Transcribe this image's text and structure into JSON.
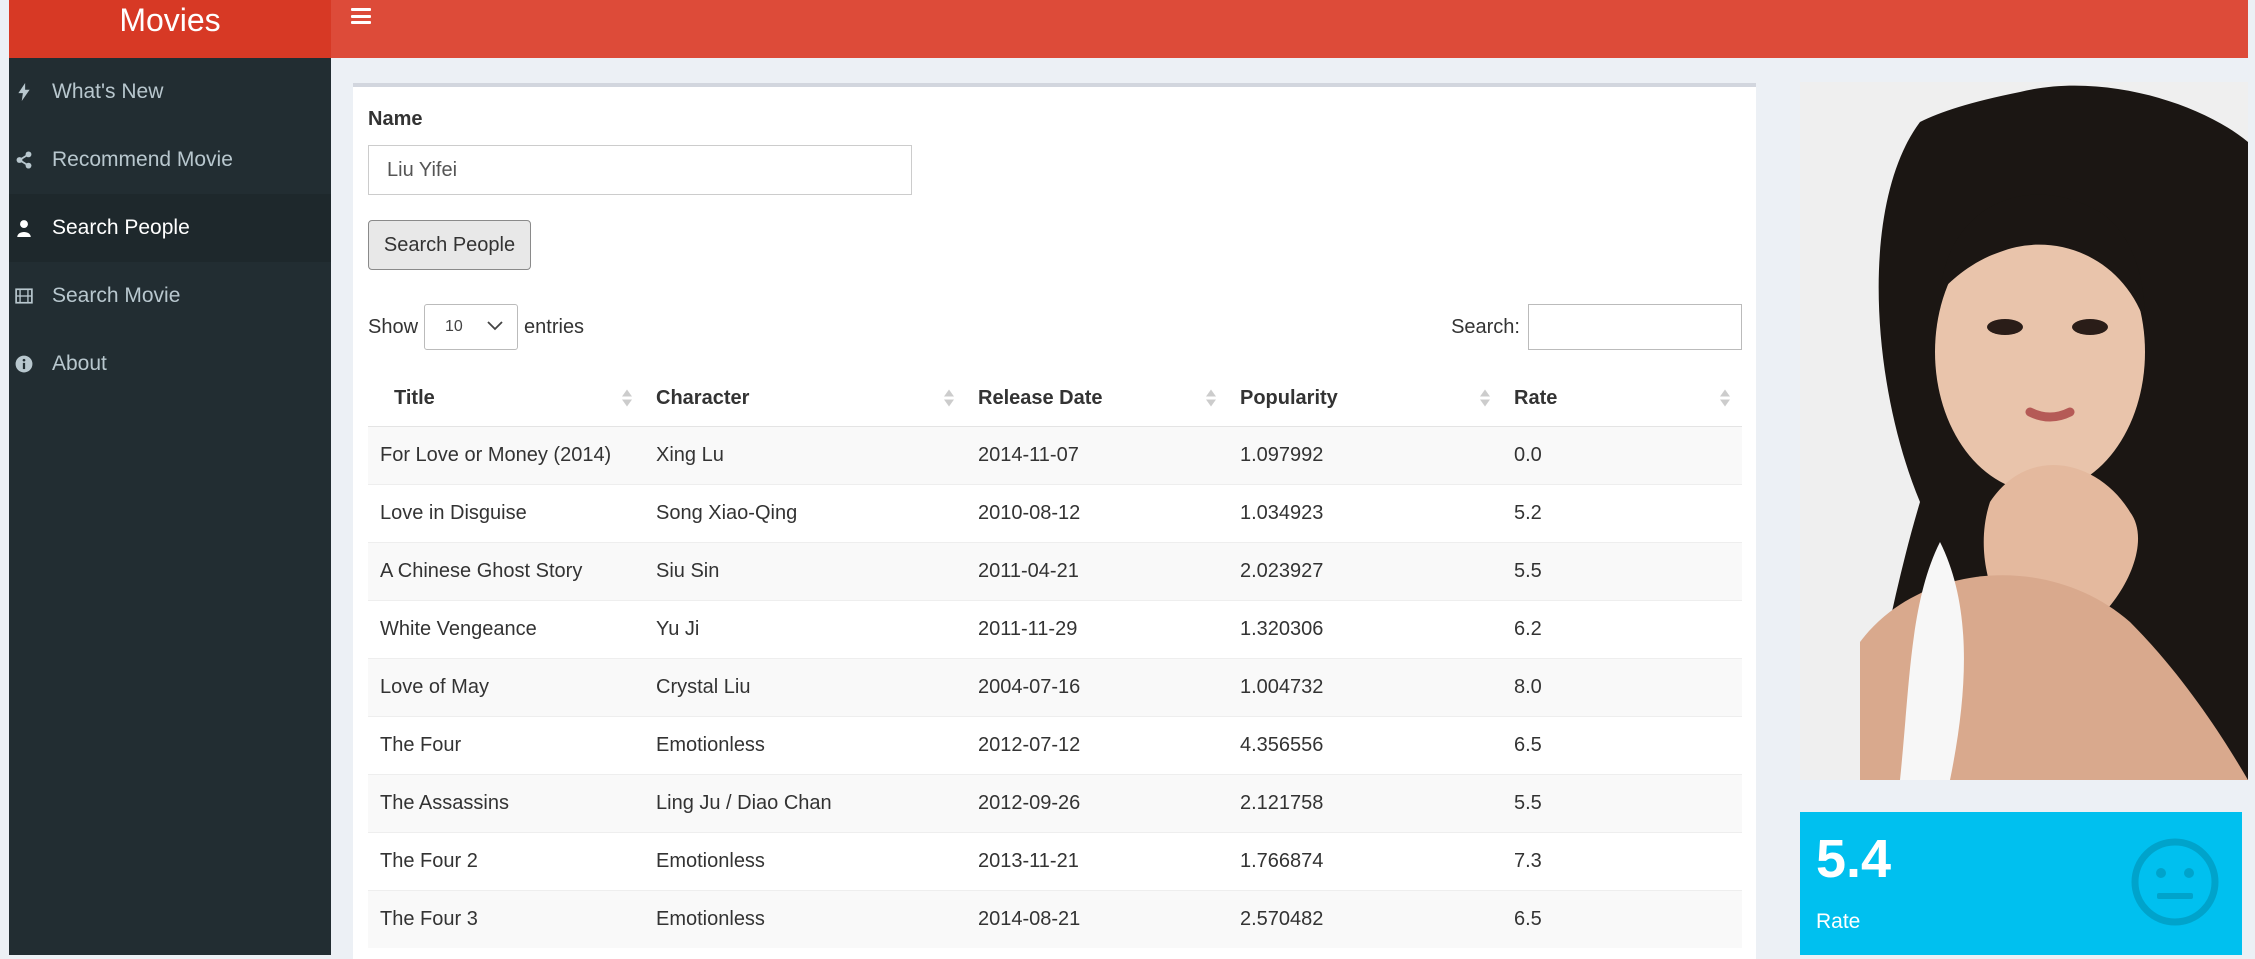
{
  "app": {
    "brand": "Movies"
  },
  "sidebar": {
    "items": [
      {
        "label": "What's New",
        "icon": "bolt-icon"
      },
      {
        "label": "Recommend Movie",
        "icon": "share-icon"
      },
      {
        "label": "Search People",
        "icon": "user-icon",
        "active": true
      },
      {
        "label": "Search Movie",
        "icon": "film-icon"
      },
      {
        "label": "About",
        "icon": "info-icon"
      }
    ]
  },
  "form": {
    "name_label": "Name",
    "name_value": "Liu Yifei",
    "search_button": "Search People"
  },
  "table_controls": {
    "show_label": "Show",
    "entries_value": "10",
    "entries_label": "entries",
    "search_label": "Search:"
  },
  "table": {
    "columns": [
      "Title",
      "Character",
      "Release Date",
      "Popularity",
      "Rate"
    ],
    "rows": [
      [
        "For Love or Money (2014)",
        "Xing Lu",
        "2014-11-07",
        "1.097992",
        "0.0"
      ],
      [
        "Love in Disguise",
        "Song Xiao-Qing",
        "2010-08-12",
        "1.034923",
        "5.2"
      ],
      [
        "A Chinese Ghost Story",
        "Siu Sin",
        "2011-04-21",
        "2.023927",
        "5.5"
      ],
      [
        "White Vengeance",
        "Yu Ji",
        "2011-11-29",
        "1.320306",
        "6.2"
      ],
      [
        "Love of May",
        "Crystal Liu",
        "2004-07-16",
        "1.004732",
        "8.0"
      ],
      [
        "The Four",
        "Emotionless",
        "2012-07-12",
        "4.356556",
        "6.5"
      ],
      [
        "The Assassins",
        "Ling Ju / Diao Chan",
        "2012-09-26",
        "2.121758",
        "5.5"
      ],
      [
        "The Four 2",
        "Emotionless",
        "2013-11-21",
        "1.766874",
        "7.3"
      ],
      [
        "The Four 3",
        "Emotionless",
        "2014-08-21",
        "2.570482",
        "6.5"
      ]
    ]
  },
  "rate_box": {
    "value": "5.4",
    "label": "Rate",
    "icon": "neutral-face-icon",
    "color": "#00c0ef"
  },
  "colors": {
    "header": "#dd4b39",
    "brand": "#d73925",
    "sidebar": "#222d32"
  }
}
